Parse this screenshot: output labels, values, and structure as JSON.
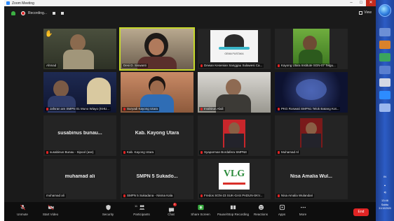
{
  "window": {
    "title": "Zoom Meeting"
  },
  "window_controls": {
    "minimize": "–",
    "maximize": "□",
    "close": "✕"
  },
  "info_bar": {
    "recording_label": "Recording...",
    "view_label": "View"
  },
  "tiles": [
    {
      "name": "Ahmad",
      "big": "",
      "muted": false,
      "hand_raised": true
    },
    {
      "name": "Desi D. Siswanti",
      "big": "",
      "muted": false,
      "hand_raised": false
    },
    {
      "name": "Dewan Kesenian Sanggau Sulawesi Ca...",
      "big": "",
      "muted": true,
      "hand_raised": false
    },
    {
      "name": "Kayong Utara Institute SGN-07 Telgu...",
      "big": "",
      "muted": true,
      "hand_raised": false
    },
    {
      "name": "Jafsran am SMPN 01 Muno Wiayo (KHU...",
      "big": "",
      "muted": true,
      "hand_raised": false
    },
    {
      "name": "Suryadi Kayong Utara",
      "big": "",
      "muted": true,
      "hand_raised": false
    },
    {
      "name": "Irvahirun Abdi",
      "big": "",
      "muted": true,
      "hand_raised": false
    },
    {
      "name": "PKG Roswati SMPN1 Telok Batang Kot...",
      "big": "",
      "muted": true,
      "hand_raised": false
    },
    {
      "name": "susabinus Bunau - Sipool (ase)",
      "big": "susabinus bunau...",
      "muted": true,
      "hand_raised": false
    },
    {
      "name": "Kab. Kayong Utara",
      "big": "Kab. Kayong Utara",
      "muted": true,
      "hand_raised": false
    },
    {
      "name": "Syaparman Bordafera SMPN8",
      "big": "",
      "muted": true,
      "hand_raised": false
    },
    {
      "name": "Muhamad Al",
      "big": "",
      "muted": true,
      "hand_raised": false
    },
    {
      "name": "muhamad ali",
      "big": "muhamad ali",
      "muted": false,
      "hand_raised": false
    },
    {
      "name": "SMPN 5 Sukadana - Nisma Kala",
      "big": "SMPN 5 Sukado...",
      "muted": true,
      "hand_raised": false
    },
    {
      "name": "Fredos SGN-23 SUK-GAS PADUN-SKV...",
      "big": "",
      "muted": true,
      "hand_raised": false
    },
    {
      "name": "Nisa Amalia Wulandari",
      "big": "Nisa Amalia Wul...",
      "muted": true,
      "hand_raised": false
    }
  ],
  "logo_tile": {
    "caption": "GEMA PUSTAKA"
  },
  "vlog_tile": {
    "text": "VLG"
  },
  "control_bar": {
    "audio": "Unmute",
    "video": "Start Video",
    "security": "Security",
    "participants": "Participants",
    "participants_count": "11",
    "chat": "Chat",
    "chat_badge": "1",
    "share": "Share Screen",
    "record": "Pause/Stop Recording",
    "reactions": "Reactions",
    "apps": "Apps",
    "more": "More",
    "end": "End"
  },
  "taskbar": {
    "lang": "IN",
    "time": "13:46",
    "day": "Sabtu",
    "date": "31/10/2020"
  },
  "colors": {
    "active_speaker_border": "#c6d92a",
    "end_button": "#e02424",
    "share_button": "#3cb043",
    "taskbar": "#2c5cc5"
  }
}
